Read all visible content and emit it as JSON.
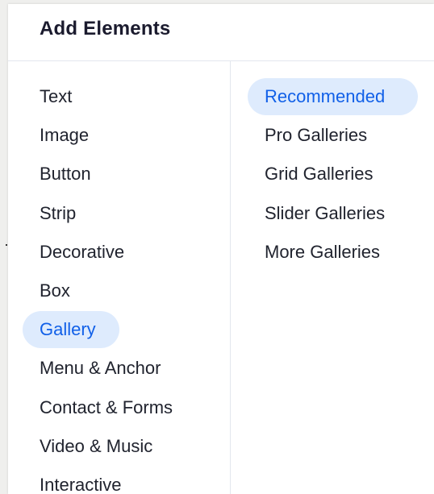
{
  "panel": {
    "title": "Add Elements"
  },
  "categories": [
    {
      "label": "Text",
      "selected": false
    },
    {
      "label": "Image",
      "selected": false
    },
    {
      "label": "Button",
      "selected": false
    },
    {
      "label": "Strip",
      "selected": false
    },
    {
      "label": "Decorative",
      "selected": false
    },
    {
      "label": "Box",
      "selected": false
    },
    {
      "label": "Gallery",
      "selected": true
    },
    {
      "label": "Menu & Anchor",
      "selected": false
    },
    {
      "label": "Contact & Forms",
      "selected": false
    },
    {
      "label": "Video & Music",
      "selected": false
    },
    {
      "label": "Interactive",
      "selected": false
    }
  ],
  "subcategories": [
    {
      "label": "Recommended",
      "selected": true
    },
    {
      "label": "Pro Galleries",
      "selected": false
    },
    {
      "label": "Grid Galleries",
      "selected": false
    },
    {
      "label": "Slider Galleries",
      "selected": false
    },
    {
      "label": "More Galleries",
      "selected": false
    }
  ],
  "colors": {
    "accent": "#1160e8",
    "selected_background": "#deebfd",
    "text": "#20232e",
    "title": "#1b1b2e",
    "divider": "#e3e7ee",
    "page_background": "#efefed"
  }
}
